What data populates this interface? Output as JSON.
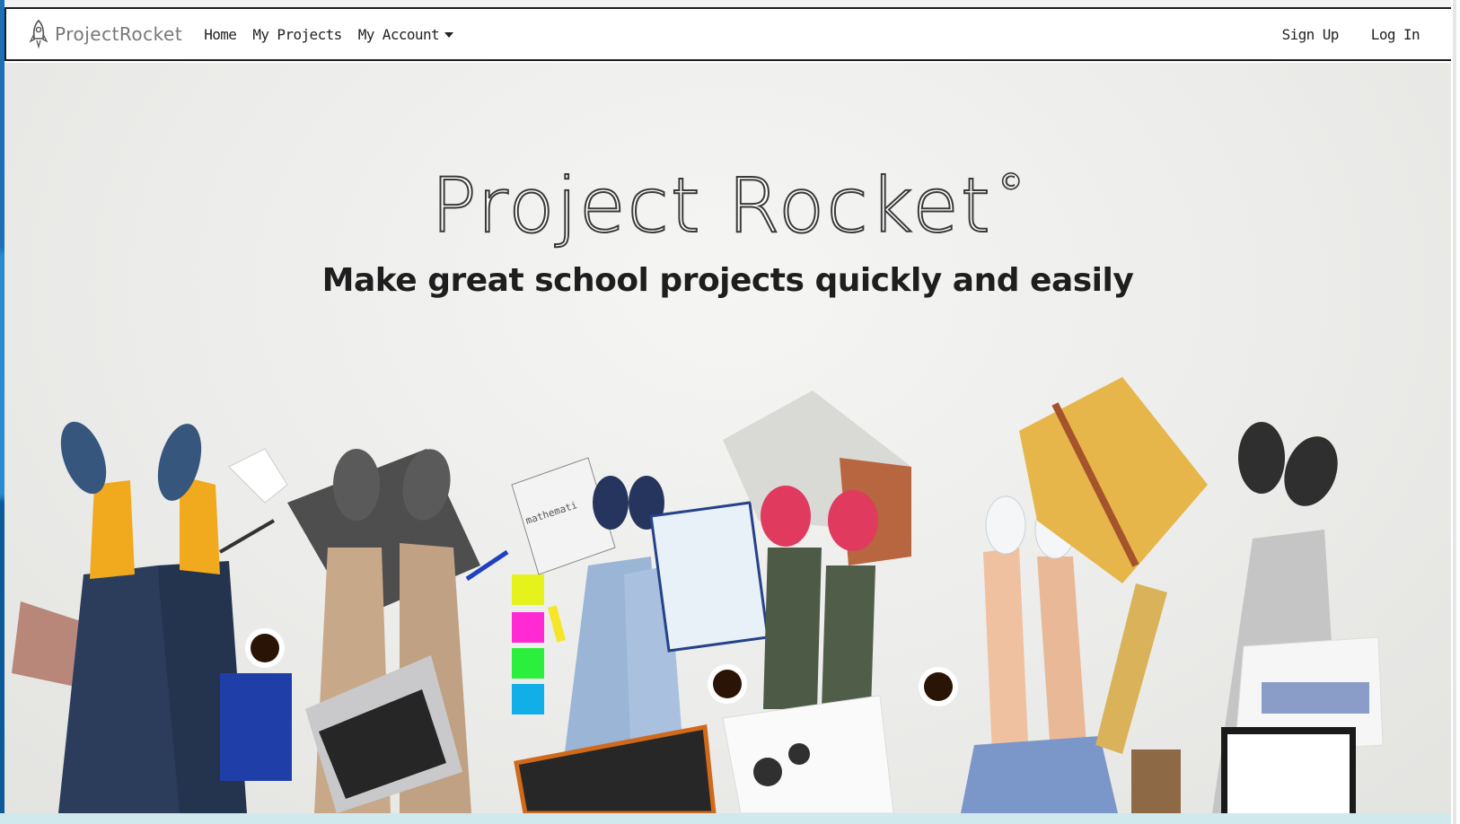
{
  "navbar": {
    "brand": "ProjectRocket",
    "links": [
      "Home",
      "My Projects",
      "My Account"
    ],
    "auth": [
      "Sign Up",
      "Log In"
    ]
  },
  "hero": {
    "title": "Project Rocket",
    "title_mark": "©",
    "subtitle": "Make great school projects quickly and easily",
    "notebook_text": "mathemati"
  },
  "colors": {
    "navbar_bg": "#ffffff",
    "navbar_border": "#1d1d1d",
    "hero_bg": "#ececea",
    "bottom_band": "#cfe9ec"
  }
}
